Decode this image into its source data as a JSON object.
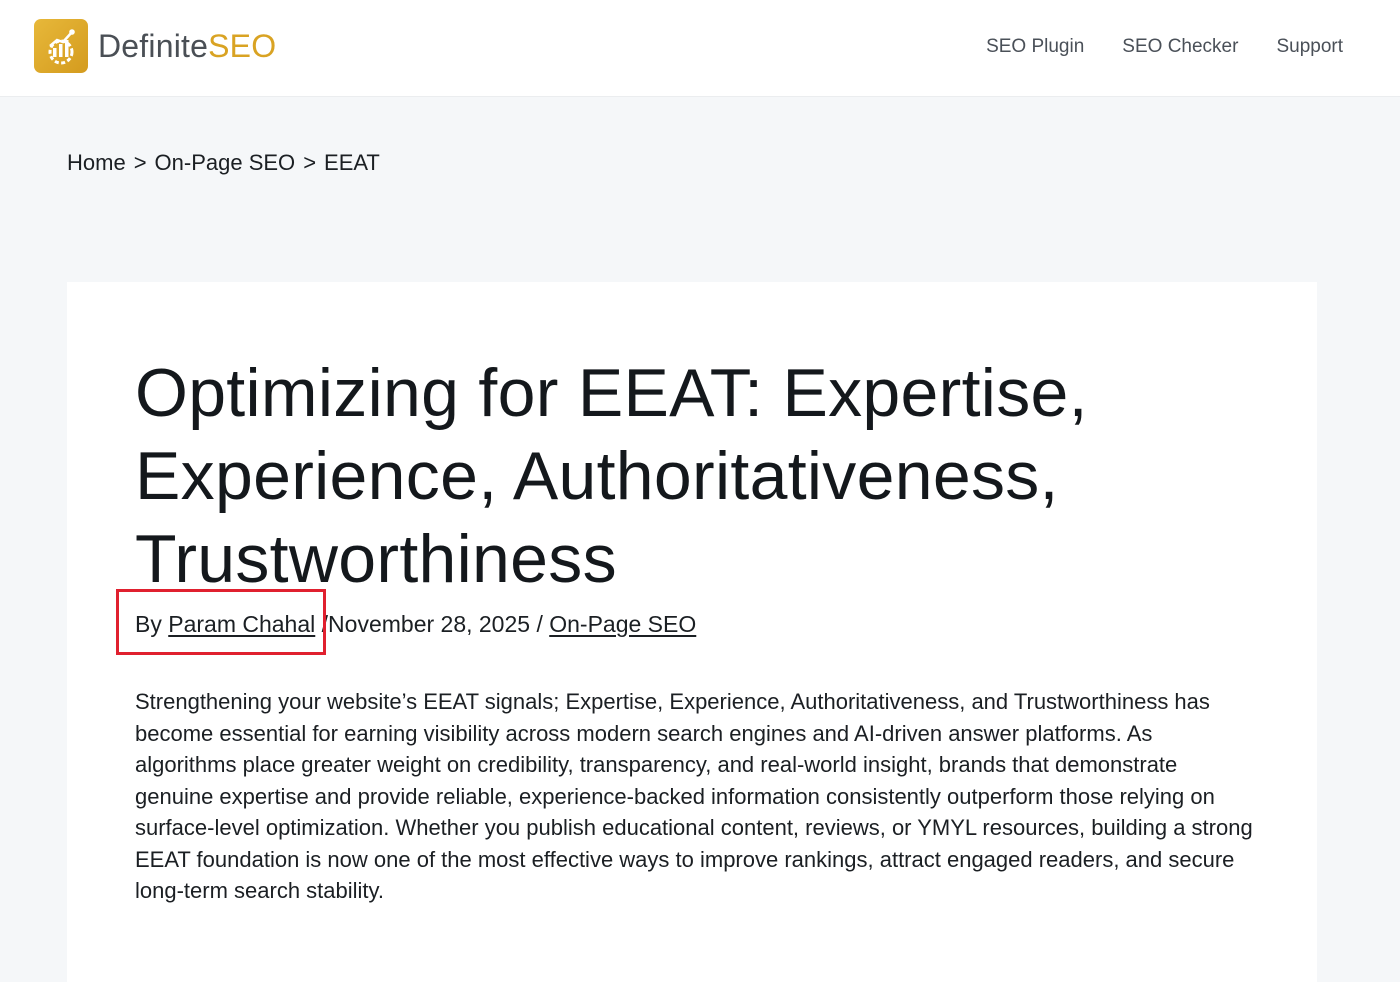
{
  "header": {
    "logo": {
      "part1": "Definite",
      "part2": "SEO",
      "icon": "chart-gear-logo-icon",
      "color": "#d9a323"
    },
    "nav": [
      {
        "label": "SEO Plugin"
      },
      {
        "label": "SEO Checker"
      },
      {
        "label": "Support"
      }
    ]
  },
  "breadcrumb": {
    "items": [
      {
        "label": "Home"
      },
      {
        "label": "On-Page SEO"
      },
      {
        "label": "EEAT"
      }
    ],
    "separator": ">"
  },
  "article": {
    "title": "Optimizing for EEAT: Expertise, Experience, Authoritativeness, Trustworthiness",
    "meta": {
      "by": "By",
      "author": "Param Chahal",
      "sep": "/",
      "date": "November 28, 2025",
      "category": "On-Page SEO"
    },
    "intro": "Strengthening your website’s EEAT signals; Expertise, Experience, Authoritativeness, and Trustworthiness has become essential for earning visibility across modern search engines and AI-driven answer platforms. As algorithms place greater weight on credibility, transparency, and real-world insight, brands that demonstrate genuine expertise and provide reliable, experience-backed information consistently outperform those relying on surface-level optimization. Whether you publish educational content, reviews, or YMYL resources, building a strong EEAT foundation is now one of the most effective ways to improve rankings, attract engaged readers, and secure long-term search stability."
  },
  "annotation": {
    "color": "#e0202f"
  }
}
